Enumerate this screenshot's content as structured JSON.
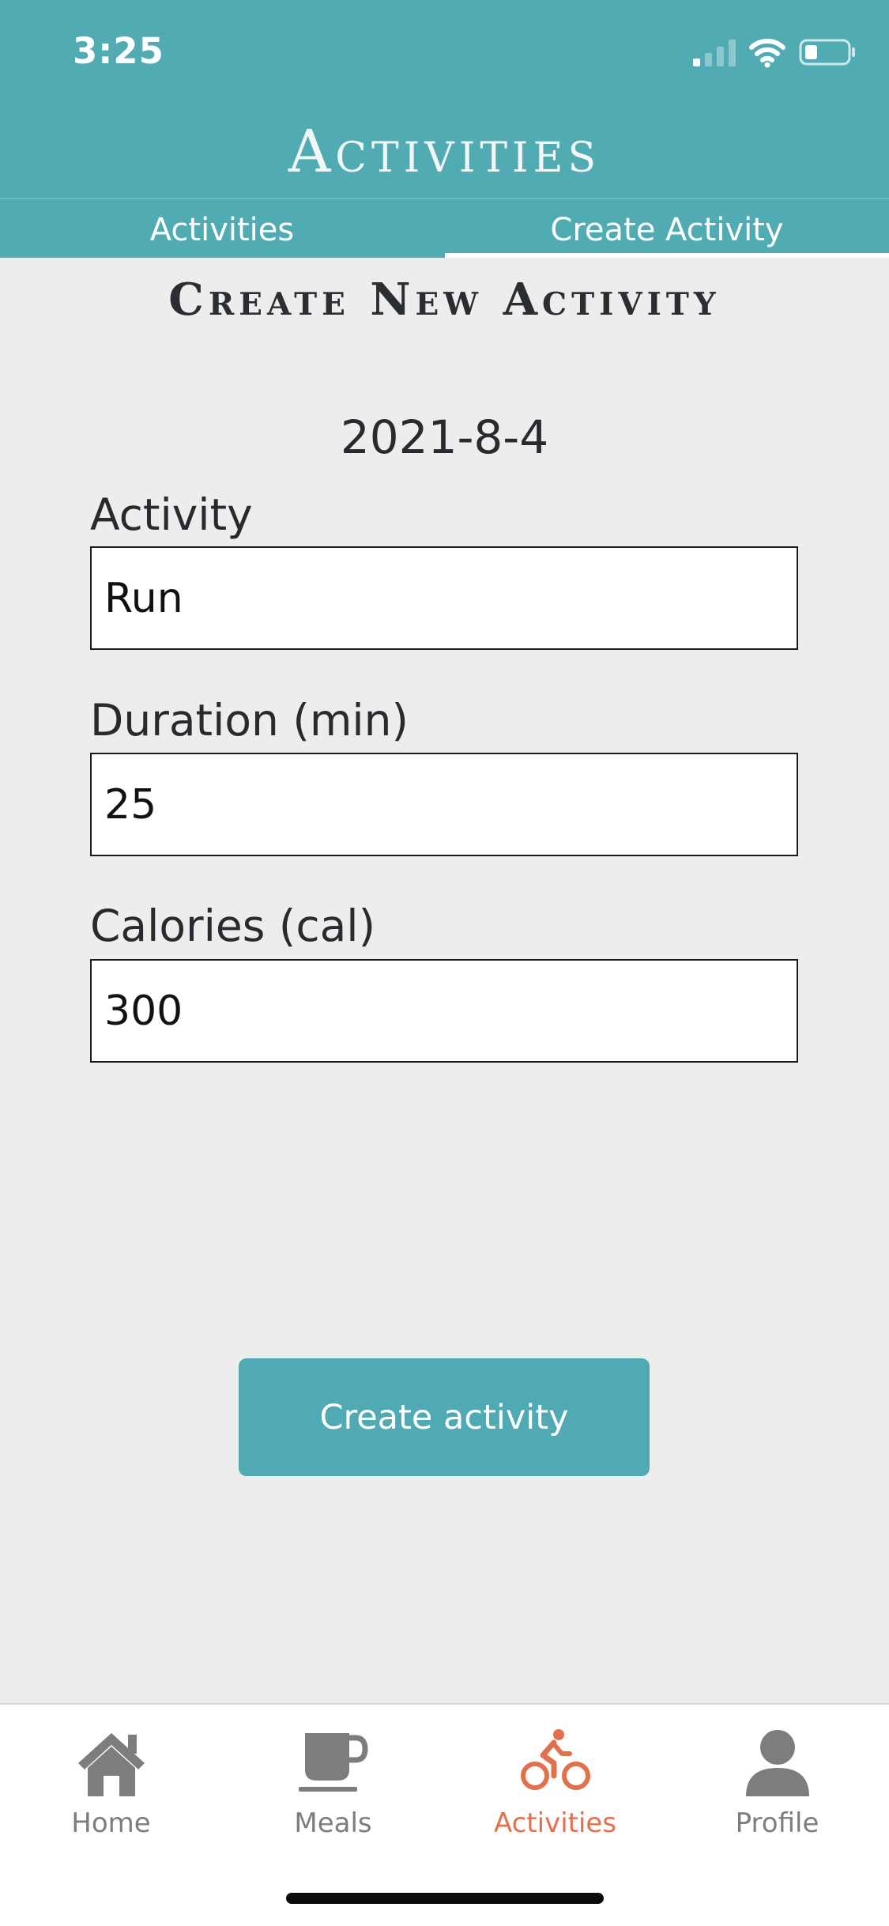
{
  "status_bar": {
    "time": "3:25",
    "icons": [
      "cellular-signal-icon",
      "wifi-icon",
      "battery-icon"
    ]
  },
  "header": {
    "title": "Activities",
    "tabs": [
      {
        "label": "Activities",
        "selected": false
      },
      {
        "label": "Create Activity",
        "selected": true
      }
    ]
  },
  "form": {
    "title": "Create New Activity",
    "date": "2021-8-4",
    "fields": [
      {
        "label": "Activity",
        "value": "Run"
      },
      {
        "label": "Duration (min)",
        "value": "25"
      },
      {
        "label": "Calories (cal)",
        "value": "300"
      }
    ],
    "submit_label": "Create activity"
  },
  "bottom_nav": {
    "items": [
      {
        "label": "Home",
        "icon": "house-icon",
        "active": false
      },
      {
        "label": "Meals",
        "icon": "coffee-cup-icon",
        "active": false
      },
      {
        "label": "Activities",
        "icon": "bicycle-rider-icon",
        "active": true
      },
      {
        "label": "Profile",
        "icon": "person-icon",
        "active": false
      }
    ]
  },
  "colors": {
    "primary": "#50abb3",
    "accent_active": "#e2704d",
    "inactive": "#7d7d7d",
    "background": "#ededed"
  }
}
